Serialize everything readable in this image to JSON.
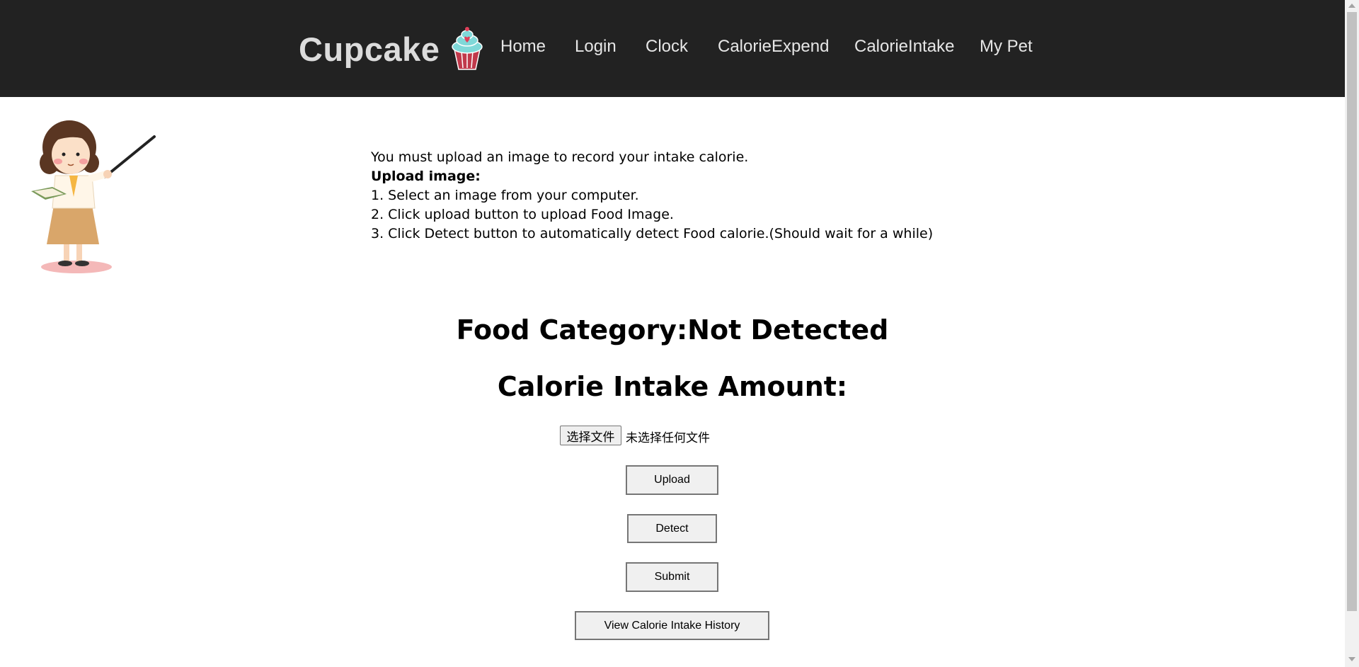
{
  "header": {
    "brand": "Cupcake",
    "logo_icon": "cupcake-icon",
    "nav": [
      {
        "label": "Home"
      },
      {
        "label": "Login"
      },
      {
        "label": "Clock"
      },
      {
        "label": "CalorieExpend"
      },
      {
        "label": "CalorieIntake"
      },
      {
        "label": "My Pet"
      }
    ],
    "background": "#222222"
  },
  "instructions": {
    "intro": "You must upload an image to record your intake calorie.",
    "title": "Upload image:",
    "steps": [
      "1. Select an image from your computer.",
      "2. Click upload button to upload Food Image.",
      "3. Click Detect button to automatically detect Food calorie.(Should wait for a while)"
    ]
  },
  "result": {
    "food_category": "Food Category:Not Detected",
    "calorie_amount": "Calorie Intake Amount:"
  },
  "file_input": {
    "button_label": "选择文件",
    "status": "未选择任何文件"
  },
  "buttons": {
    "upload": "Upload",
    "detect": "Detect",
    "submit": "Submit",
    "history": "View Calorie Intake History"
  },
  "illustration_icon": "teacher-illustration-icon"
}
